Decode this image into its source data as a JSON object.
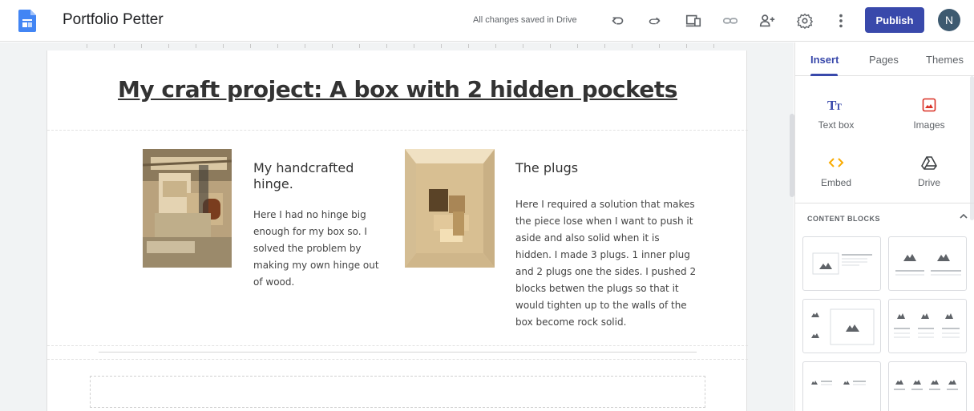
{
  "topbar": {
    "title": "Portfolio Petter",
    "save_status": "All changes saved in Drive",
    "publish_label": "Publish",
    "avatar_initial": "N",
    "icons": [
      "undo-icon",
      "redo-icon",
      "preview-icon",
      "link-icon",
      "share-icon",
      "settings-icon",
      "more-vert-icon"
    ]
  },
  "page": {
    "title": "My craft project: A box with 2 hidden pockets",
    "cards": [
      {
        "heading": "My handcrafted hinge.",
        "body": "Here I had no hinge big enough for my box so. I solved the problem by making my own hinge out of wood."
      },
      {
        "heading": "The plugs",
        "body": "Here I required a solution that makes the piece lose when I want to push it aside and also solid when it is hidden.  I made 3 plugs. 1 inner plug and 2 plugs one the sides. I pushed 2 blocks betwen the plugs so that it would tighten up to the walls of the box become rock solid."
      }
    ]
  },
  "side_panel": {
    "tabs": [
      "Insert",
      "Pages",
      "Themes"
    ],
    "active_tab": "Insert",
    "insert_items": [
      {
        "label": "Text box",
        "icon": "text-box-icon"
      },
      {
        "label": "Images",
        "icon": "image-icon"
      },
      {
        "label": "Embed",
        "icon": "embed-icon"
      },
      {
        "label": "Drive",
        "icon": "drive-icon"
      }
    ],
    "content_blocks_title": "CONTENT BLOCKS"
  },
  "colors": {
    "accent": "#3949ab",
    "avatar": "#3d5a70",
    "sites_logo": "#4285f4"
  }
}
